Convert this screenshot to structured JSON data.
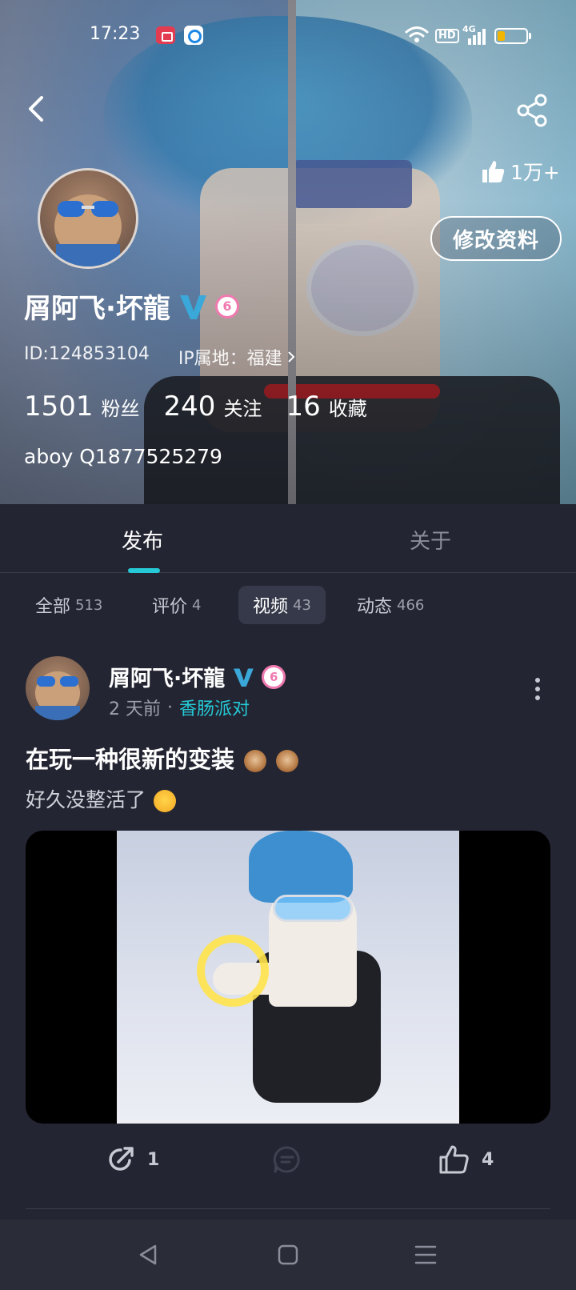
{
  "status_bar": {
    "time": "17:23",
    "hd": "HD",
    "network": "4G",
    "icons": [
      "screen-record-icon",
      "browser-icon",
      "wifi-icon",
      "signal-icon",
      "battery-icon"
    ],
    "battery_level": 0.25
  },
  "header": {
    "likes": "1万+",
    "edit_profile": "修改资料"
  },
  "profile": {
    "username": "屑阿飞·坏龍",
    "level": "6",
    "id_text": "ID:124853104",
    "ip_text": "IP属地：福建",
    "stats": [
      {
        "value": "1501",
        "label": "粉丝"
      },
      {
        "value": "240",
        "label": "关注"
      },
      {
        "value": "16",
        "label": "收藏"
      }
    ],
    "bio": "aboy Q1877525279"
  },
  "tabs": {
    "publish": "发布",
    "about": "关于",
    "active": "发布"
  },
  "filters": [
    {
      "label": "全部",
      "count": "513"
    },
    {
      "label": "评价",
      "count": "4"
    },
    {
      "label": "视频",
      "count": "43"
    },
    {
      "label": "动态",
      "count": "466"
    }
  ],
  "post": {
    "author": "屑阿飞·坏龍",
    "level": "6",
    "time": "2 天前",
    "dot": "·",
    "topic": "香肠派对",
    "title": "在玩一种很新的变装",
    "body": "好久没整活了",
    "shares": "1",
    "likes": "4"
  },
  "colors": {
    "accent": "#26c9d6",
    "background": "#232532",
    "verified": "#3aa8d8",
    "level_badge": "#f07ab0"
  }
}
